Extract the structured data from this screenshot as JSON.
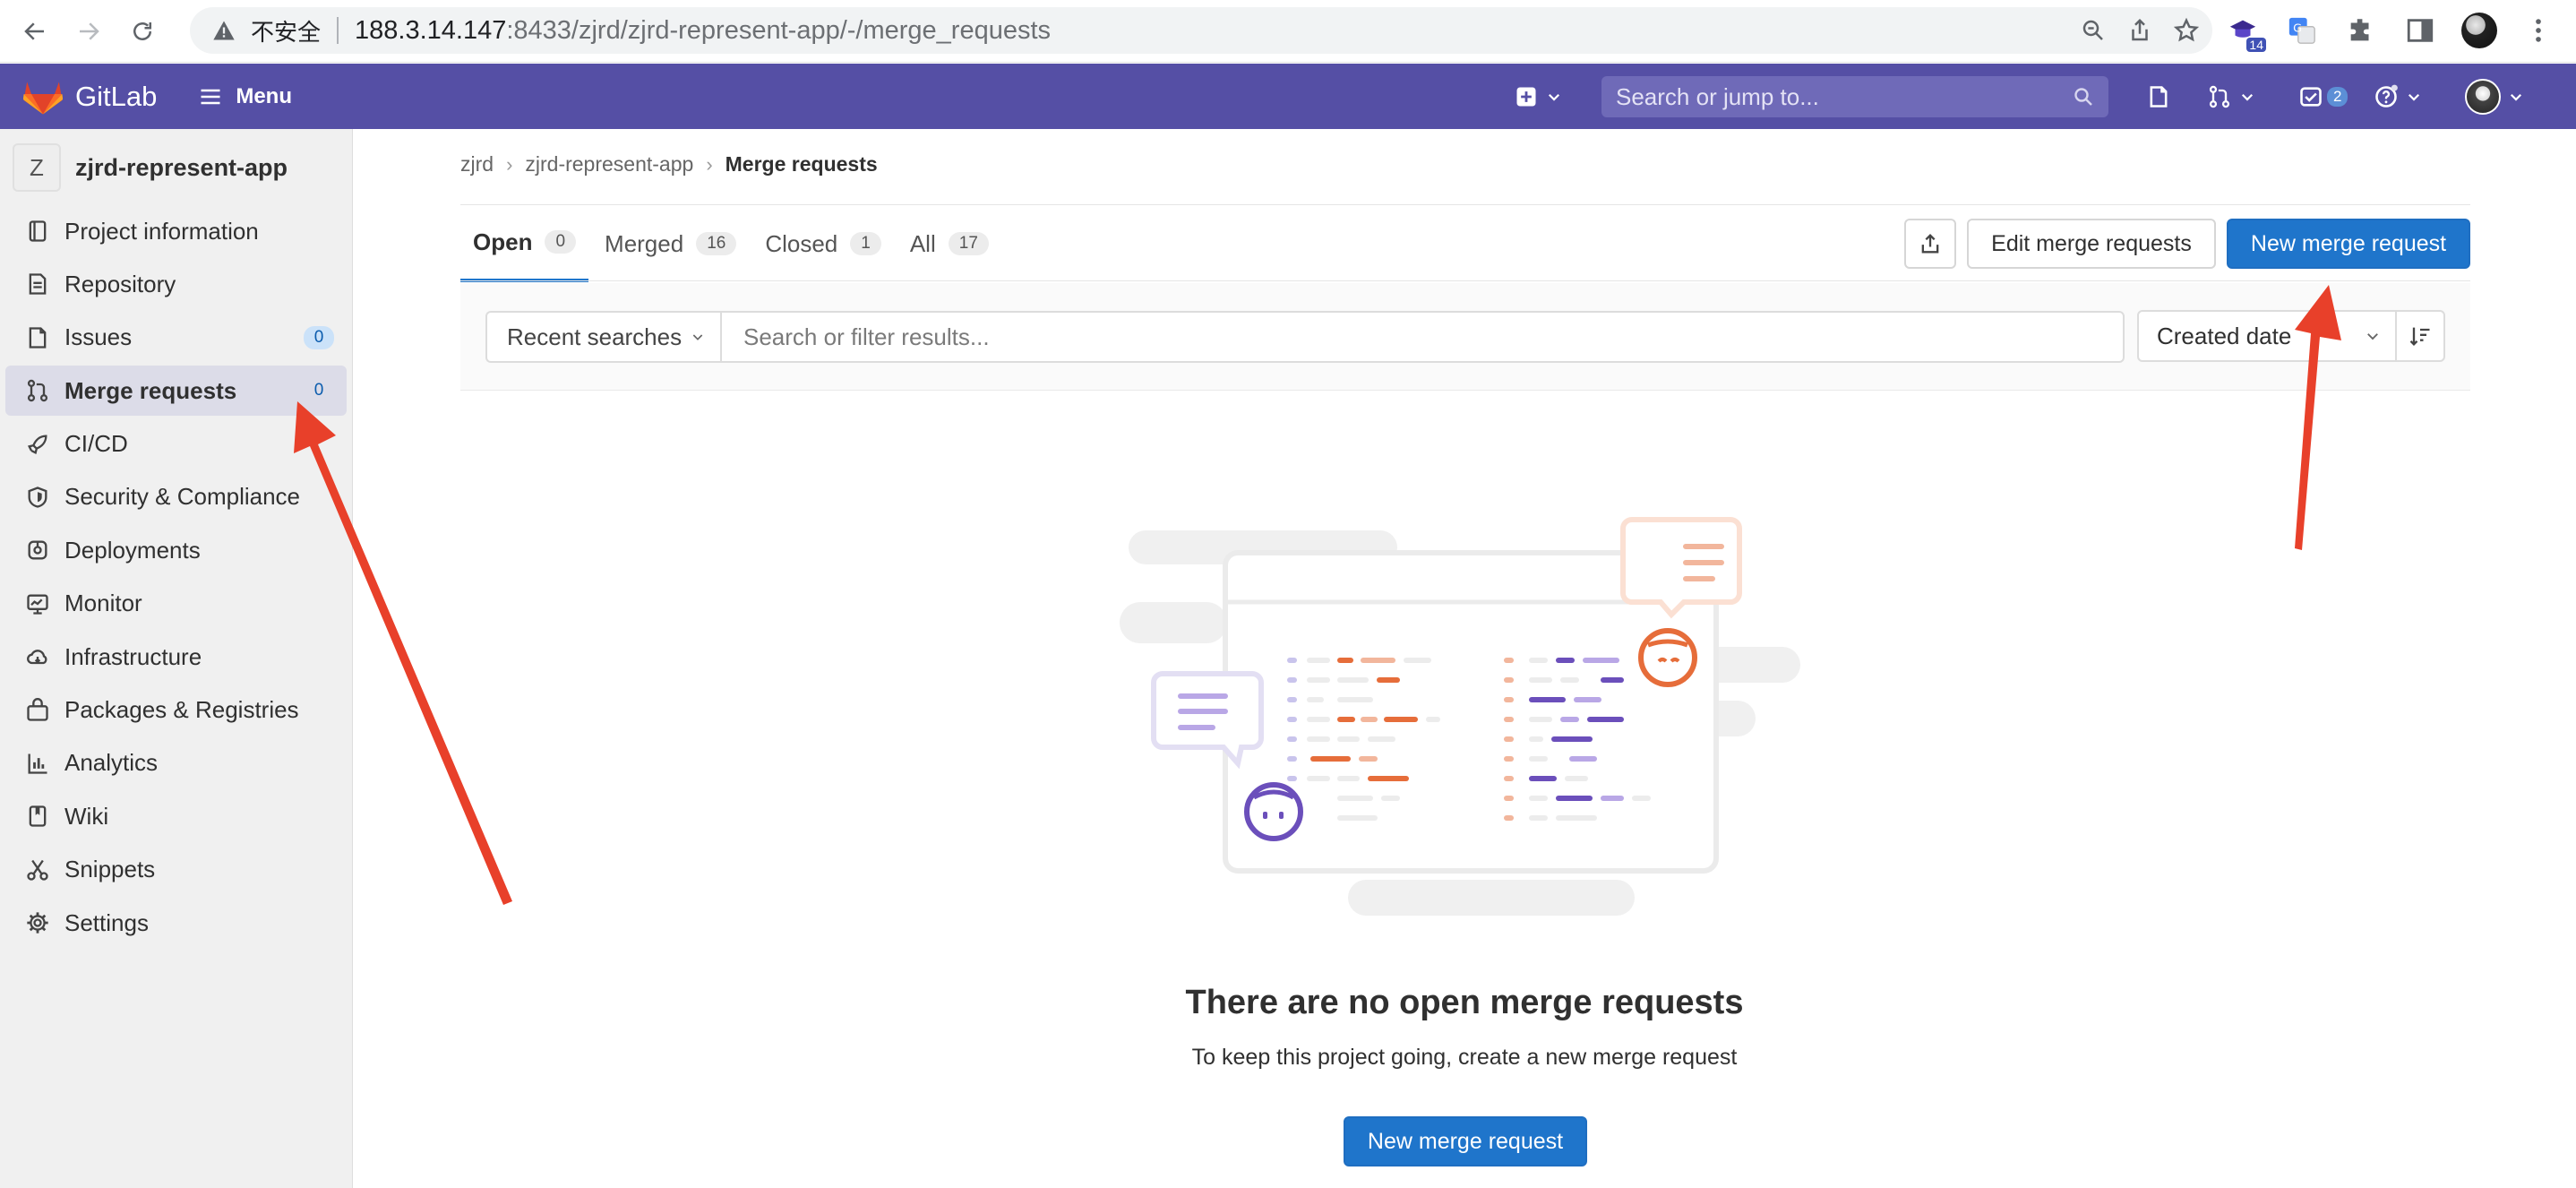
{
  "browser": {
    "insecure_label": "不安全",
    "url_host": "188.3.14.147",
    "url_path": ":8433/zjrd/zjrd-represent-app/-/merge_requests",
    "extension_badge": "14"
  },
  "topbar": {
    "brand": "GitLab",
    "menu_label": "Menu",
    "search_placeholder": "Search or jump to...",
    "todo_count": "2"
  },
  "sidebar": {
    "project_initial": "Z",
    "project_name": "zjrd-represent-app",
    "items": [
      {
        "label": "Project information",
        "icon": "project-icon"
      },
      {
        "label": "Repository",
        "icon": "doc-icon"
      },
      {
        "label": "Issues",
        "icon": "issues-icon",
        "count": "0"
      },
      {
        "label": "Merge requests",
        "icon": "git-merge-icon",
        "count": "0",
        "active": true
      },
      {
        "label": "CI/CD",
        "icon": "rocket-icon"
      },
      {
        "label": "Security & Compliance",
        "icon": "shield-icon"
      },
      {
        "label": "Deployments",
        "icon": "deployments-icon"
      },
      {
        "label": "Monitor",
        "icon": "monitor-icon"
      },
      {
        "label": "Infrastructure",
        "icon": "cloud-icon"
      },
      {
        "label": "Packages & Registries",
        "icon": "package-icon"
      },
      {
        "label": "Analytics",
        "icon": "chart-icon"
      },
      {
        "label": "Wiki",
        "icon": "book-icon"
      },
      {
        "label": "Snippets",
        "icon": "scissors-icon"
      },
      {
        "label": "Settings",
        "icon": "gear-icon"
      }
    ]
  },
  "breadcrumb": [
    "zjrd",
    "zjrd-represent-app",
    "Merge requests"
  ],
  "tabs": [
    {
      "label": "Open",
      "count": "0"
    },
    {
      "label": "Merged",
      "count": "16"
    },
    {
      "label": "Closed",
      "count": "1"
    },
    {
      "label": "All",
      "count": "17"
    }
  ],
  "actions": {
    "edit": "Edit merge requests",
    "new": "New merge request"
  },
  "filter": {
    "recent": "Recent searches",
    "placeholder": "Search or filter results...",
    "sort": "Created date"
  },
  "empty_state": {
    "title": "There are no open merge requests",
    "subtitle": "To keep this project going, create a new merge request",
    "button": "New merge request"
  },
  "colors": {
    "topbar": "#554fa5",
    "primary": "#1f75cb",
    "annotation_arrow": "#e8402a"
  }
}
